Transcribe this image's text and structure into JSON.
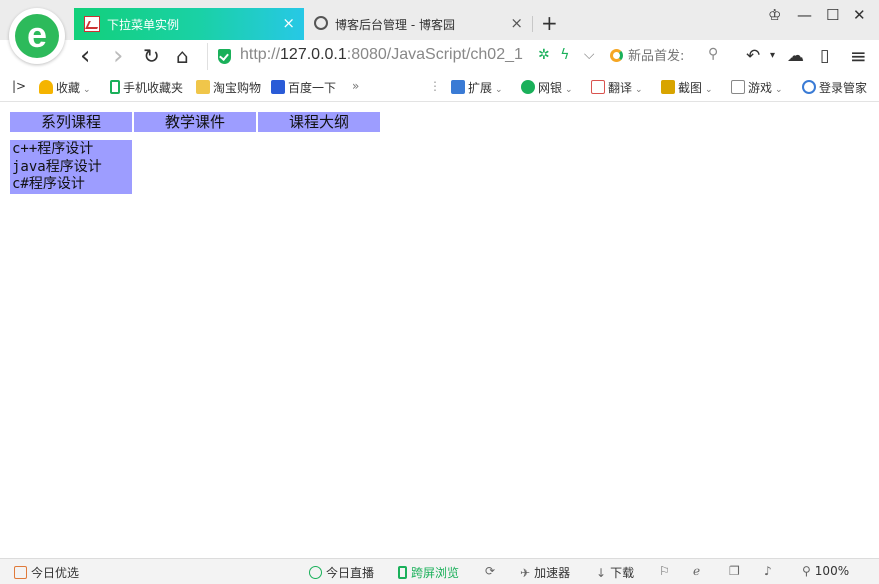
{
  "browser": {
    "logo_letter": "e",
    "tabs": [
      {
        "title": "下拉菜单实例",
        "close": "×"
      },
      {
        "title": "博客后台管理 - 博客园",
        "close": "×"
      }
    ],
    "new_tab": "+",
    "window_controls": {
      "skin": "♔",
      "minimize": "—",
      "maximize": "☐",
      "close": "✕"
    },
    "nav": {
      "back": "‹",
      "forward": "›",
      "reload": "↻",
      "home": "⌂"
    },
    "address": {
      "scheme": "http://",
      "host": "127.0.0.1",
      "rest": ":8080/JavaScript/ch02_1"
    },
    "address_icons": {
      "recycle": "✲",
      "bolt": "ϟ",
      "dropdown": "⌵"
    },
    "search_placeholder": "新品首发:",
    "search_icon": "⚲",
    "tools": {
      "undo": "↶",
      "undo_caret": "▾",
      "cloud": "☁",
      "phone": "▯",
      "menu": "≡"
    }
  },
  "bookmarks": {
    "toggle": "|>",
    "items": [
      {
        "label": "收藏",
        "caret": true,
        "icon": "star-icon",
        "color": "#f5b400"
      },
      {
        "label": "手机收藏夹",
        "caret": false,
        "icon": "phone-icon",
        "color": "#1ab05a"
      },
      {
        "label": "淘宝购物",
        "caret": false,
        "icon": "folder-icon",
        "color": "#f0c64a"
      },
      {
        "label": "百度一下",
        "caret": false,
        "icon": "paw-icon",
        "color": "#2a5bd7"
      }
    ],
    "more": "»",
    "right_items": [
      {
        "label": "扩展",
        "icon": "extension-icon",
        "color": "#3a7bd5"
      },
      {
        "label": "网银",
        "icon": "bank-icon",
        "color": "#1ab05a"
      },
      {
        "label": "翻译",
        "icon": "translate-icon",
        "color": "#d9534f"
      },
      {
        "label": "截图",
        "icon": "scissors-icon",
        "color": "#d8a400"
      },
      {
        "label": "游戏",
        "icon": "gamepad-icon",
        "color": "#888888"
      },
      {
        "label": "登录管家",
        "icon": "key-icon",
        "color": "#3a7bd5"
      }
    ]
  },
  "page": {
    "menus": [
      "系列课程",
      "教学课件",
      "课程大纲"
    ],
    "submenu": [
      "c++程序设计",
      "java程序设计",
      "c#程序设计"
    ],
    "menu_color": "#9d9dff"
  },
  "statusbar": {
    "left": "今日优选",
    "live": "今日直播",
    "cross_screen": "跨屏浏览",
    "accelerator": "加速器",
    "download": "下载",
    "zoom": "100%"
  }
}
